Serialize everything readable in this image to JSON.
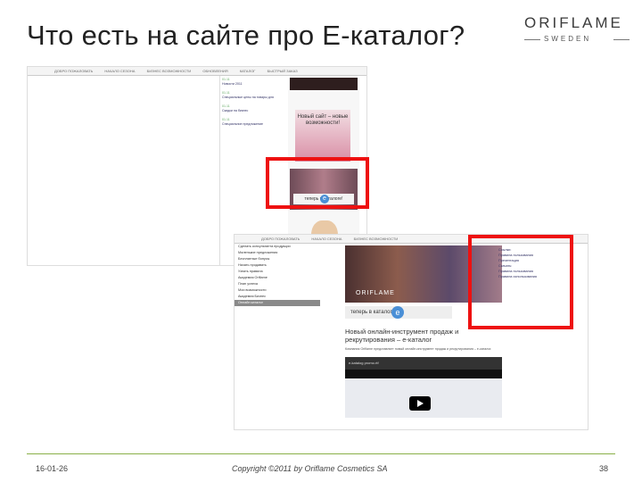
{
  "slide": {
    "title": "Что есть на сайте про E-каталог?",
    "logo": {
      "brand": "ORIFLAME",
      "sub": "SWEDEN"
    },
    "footer": {
      "date": "16-01-26",
      "copyright": "Copyright ©2011 by Oriflame Cosmetics SA",
      "page": "38"
    }
  },
  "screenshot1": {
    "nav": [
      "ДОБРО ПОЖАЛОВАТЬ",
      "НАЧАЛО СЕЗОНА",
      "БИЗНЕС ВОЗМОЖНОСТИ",
      "ОБНОВЛЕНИЯ",
      "КАТАЛОГ",
      "БЫСТРЫЙ ЗАКАЗ"
    ],
    "news": [
      {
        "date": "01.11",
        "text": "Новости 2011"
      },
      {
        "date": "01.11",
        "text": "Специальные цены на товары для"
      },
      {
        "date": "01.11",
        "text": "Скидки на бизнес"
      },
      {
        "date": "01.11",
        "text": "Специальное предложение"
      }
    ],
    "banner_new": "Новый сайт – новые возможности!",
    "catalog_banner": "теперь в  каталоге!"
  },
  "screenshot2": {
    "nav": [
      "ДОБРО ПОЖАЛОВАТЬ",
      "НАЧАЛО СЕЗОНА",
      "БИЗНЕС ВОЗМОЖНОСТИ"
    ],
    "menu": [
      "Сделать консультанта продукции",
      "Маленькие предложения",
      "Бесплатные бонусы",
      "Начать продавать",
      "Узнать правила",
      "Академия Оriflame",
      "План успеха",
      "Мои возможности",
      "Академия Бизнес",
      "Онлайн каталог"
    ],
    "menu_selected": "Онлайн каталог",
    "hero_brand": "ORIFLAME",
    "e_bar": "теперь в        каталоге!",
    "headline": "Новый онлайн-инструмент продаж и рекрутирования – е-каталог",
    "body": "Компания Oriflame представляет новый онлайн-инструмент продаж и рекрутирования – е-каталог.",
    "video_title": "e-katalog promo.rtf",
    "right_links": [
      "Ссылки:",
      "Правила пользования",
      "Презентация",
      "Скачать:",
      "Правила пользования",
      "Правила использования"
    ]
  }
}
